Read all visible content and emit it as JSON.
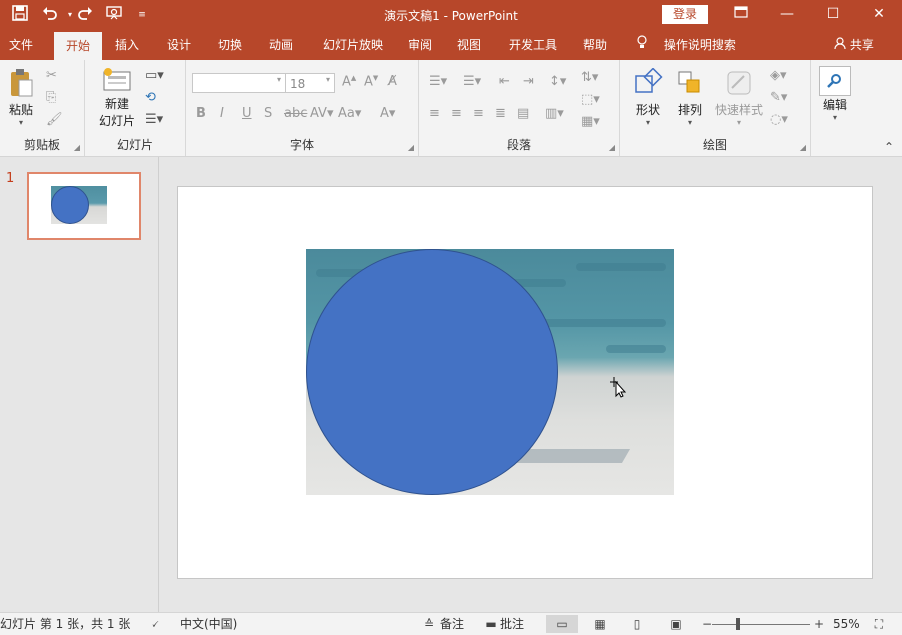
{
  "app": {
    "title": "演示文稿1  -  PowerPoint",
    "login_label": "登录",
    "brand_color": "#b7472a"
  },
  "quick_access": {
    "icons": [
      "save-icon",
      "undo-icon",
      "redo-icon",
      "present-from-start-icon",
      "customize-icon"
    ]
  },
  "window_controls": {
    "ribbon_options_icon": "ribbon-display-icon",
    "minimize": "—",
    "maximize": "☐",
    "close": "✕"
  },
  "tabs": [
    {
      "label": "文件"
    },
    {
      "label": "开始",
      "active": true
    },
    {
      "label": "插入"
    },
    {
      "label": "设计"
    },
    {
      "label": "切换"
    },
    {
      "label": "动画"
    },
    {
      "label": "幻灯片放映"
    },
    {
      "label": "审阅"
    },
    {
      "label": "视图"
    },
    {
      "label": "开发工具"
    },
    {
      "label": "帮助"
    }
  ],
  "tell_me": "操作说明搜索",
  "share": "共享",
  "ribbon": {
    "clipboard": {
      "label": "剪贴板",
      "paste": "粘贴"
    },
    "slides": {
      "label": "幻灯片",
      "new_slide_line1": "新建",
      "new_slide_line2": "幻灯片"
    },
    "font": {
      "label": "字体",
      "font_name": "",
      "font_size": "18"
    },
    "paragraph": {
      "label": "段落"
    },
    "drawing": {
      "label": "绘图",
      "shapes": "形状",
      "arrange": "排列",
      "quick_styles": "快速样式"
    },
    "editing": {
      "label": "编辑"
    }
  },
  "thumbnails": {
    "slide_number": "1"
  },
  "status": {
    "slide_info": "幻灯片 第 1 张，共 1 张",
    "language": "中文(中国)",
    "notes": "备注",
    "comments": "批注",
    "zoom": "55%"
  }
}
